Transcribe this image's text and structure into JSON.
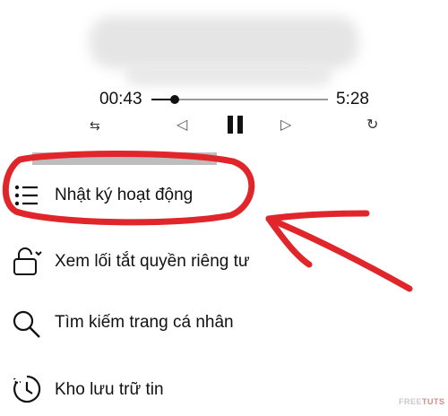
{
  "player": {
    "current_time": "00:43",
    "total_time": "5:28",
    "progress": 0.13
  },
  "menu": [
    {
      "label": "Nhật ký hoạt động",
      "icon": "activity-log-icon"
    },
    {
      "label": "Xem lối tắt quyền riêng tư",
      "icon": "privacy-lock-icon"
    },
    {
      "label": "Tìm kiếm trang cá nhân",
      "icon": "search-icon"
    },
    {
      "label": "Kho lưu trữ tin",
      "icon": "story-archive-icon"
    }
  ],
  "annotation": {
    "color": "#e0262b"
  },
  "watermark": {
    "part1": "FREE",
    "part2": "TUTS"
  }
}
